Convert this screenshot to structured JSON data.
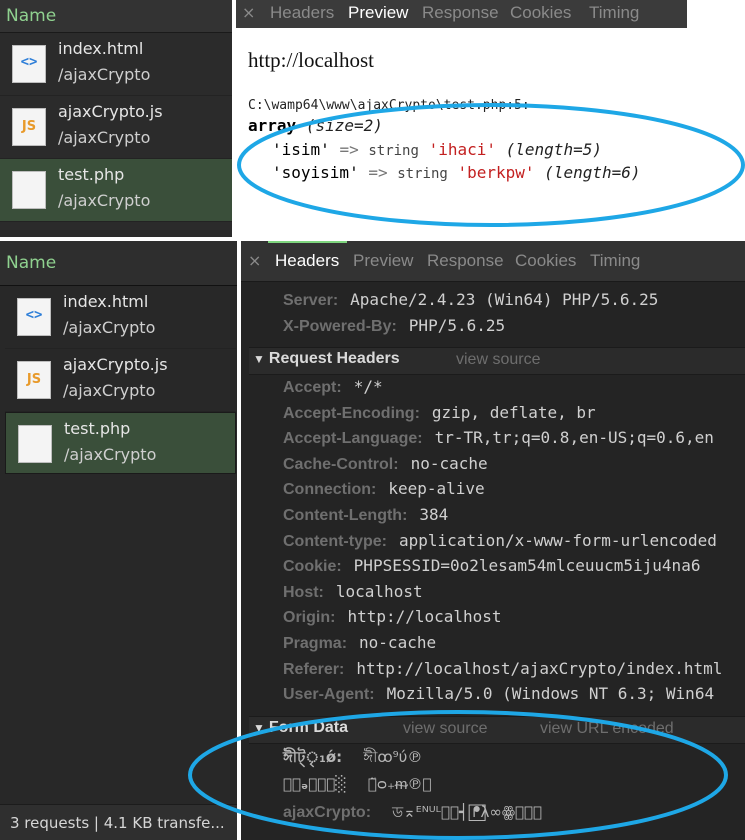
{
  "top": {
    "name_header": "Name",
    "files": [
      {
        "name": "index.html",
        "path": "/ajaxCrypto",
        "icon": "html-file-icon"
      },
      {
        "name": "ajaxCrypto.js",
        "path": "/ajaxCrypto",
        "icon": "js-file-icon"
      },
      {
        "name": "test.php",
        "path": "/ajaxCrypto",
        "icon": "php-file-icon",
        "selected": true
      }
    ],
    "tabs": [
      "Headers",
      "Preview",
      "Response",
      "Cookies",
      "Timing"
    ],
    "active_tab": "Preview",
    "close": "×",
    "preview": {
      "url": "http://localhost",
      "path": "C:\\wamp64\\www\\ajaxCrypto\\test.php:5:",
      "array_kw": "array",
      "array_size": "(size=2)",
      "rows": [
        {
          "key": "'isim'",
          "arrow": "=>",
          "type": "string",
          "value": "'ihaci'",
          "length": "(length=5)"
        },
        {
          "key": "'soyisim'",
          "arrow": "=>",
          "type": "string",
          "value": "'berkpw'",
          "length": "(length=6)"
        }
      ]
    }
  },
  "bottom": {
    "name_header": "Name",
    "files": [
      {
        "name": "index.html",
        "path": "/ajaxCrypto",
        "icon": "html-file-icon"
      },
      {
        "name": "ajaxCrypto.js",
        "path": "/ajaxCrypto",
        "icon": "js-file-icon"
      },
      {
        "name": "test.php",
        "path": "/ajaxCrypto",
        "icon": "php-file-icon",
        "selected": true
      }
    ],
    "status": "3 requests  |  4.1 KB transfe...",
    "tabs": [
      "Headers",
      "Preview",
      "Response",
      "Cookies",
      "Timing"
    ],
    "active_tab": "Headers",
    "close": "×",
    "response_headers": [
      {
        "key": "Server:",
        "value": "Apache/2.4.23 (Win64) PHP/5.6.25"
      },
      {
        "key": "X-Powered-By:",
        "value": "PHP/5.6.25"
      }
    ],
    "request_section": {
      "title": "Request Headers",
      "view_source": "view source"
    },
    "request_headers": [
      {
        "key": "Accept:",
        "value": "*/*"
      },
      {
        "key": "Accept-Encoding:",
        "value": "gzip, deflate, br"
      },
      {
        "key": "Accept-Language:",
        "value": "tr-TR,tr;q=0.8,en-US;q=0.6,en"
      },
      {
        "key": "Cache-Control:",
        "value": "no-cache"
      },
      {
        "key": "Connection:",
        "value": "keep-alive"
      },
      {
        "key": "Content-Length:",
        "value": "384"
      },
      {
        "key": "Content-type:",
        "value": "application/x-www-form-urlencoded"
      },
      {
        "key": "Cookie:",
        "value": "PHPSESSID=0o2lesam54mlceuucm5iju4na6"
      },
      {
        "key": "Host:",
        "value": "localhost"
      },
      {
        "key": "Origin:",
        "value": "http://localhost"
      },
      {
        "key": "Pragma:",
        "value": "no-cache"
      },
      {
        "key": "Referer:",
        "value": "http://localhost/ajaxCrypto/index.html"
      },
      {
        "key": "User-Agent:",
        "value": "Mozilla/5.0 (Windows NT 6.3; Win64"
      }
    ],
    "form_section": {
      "title": "Form Data",
      "view_source": "view source",
      "view_url": "view URL encoded"
    },
    "form_rows": [
      {
        "key": "ঈীট্ৃ₁ǿ:",
        "value": "ঈীꝏ⁹ύ℗"
      },
      {
        "key": "⃞⃞ₔ⃞⃞⃞░",
        "value": "ঁ̃ᴑ₊ᵯ℗⃞"
      },
      {
        "key": "ajaxCrypto:",
        "value": "ড⌅ᴱᴺᵁᴸ⃞⃞┥ ᖰ⃞λ∞ꙮ⃞⃞⃞"
      }
    ]
  },
  "colors": {
    "highlight_ellipse": "#1ea7e6",
    "accent_green": "#7fd67f",
    "string_red": "#c32020"
  }
}
